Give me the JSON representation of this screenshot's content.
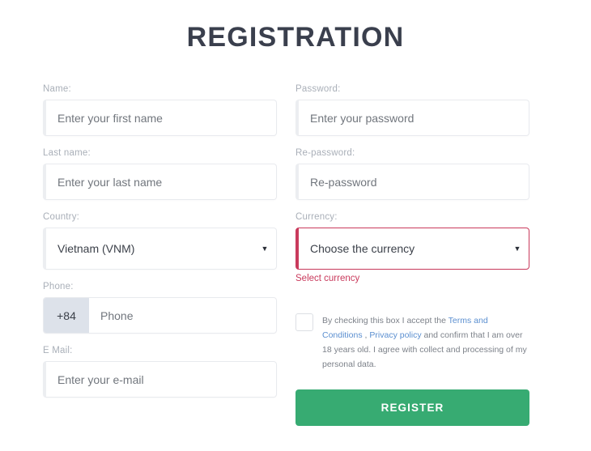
{
  "header": {
    "title": "REGISTRATION"
  },
  "form": {
    "left": {
      "name": {
        "label": "Name:",
        "placeholder": "Enter your first name",
        "value": ""
      },
      "last_name": {
        "label": "Last name:",
        "placeholder": "Enter your last name",
        "value": ""
      },
      "country": {
        "label": "Country:",
        "selected": "Vietnam (VNM)",
        "caret": "▼"
      },
      "phone": {
        "label": "Phone:",
        "prefix": "+84",
        "placeholder": "Phone",
        "value": ""
      },
      "email": {
        "label": "E Mail:",
        "placeholder": "Enter your e-mail",
        "value": ""
      }
    },
    "right": {
      "password": {
        "label": "Password:",
        "placeholder": "Enter your password",
        "value": ""
      },
      "re_password": {
        "label": "Re-password:",
        "placeholder": "Re-password",
        "value": ""
      },
      "currency": {
        "label": "Currency:",
        "selected": "Choose the currency",
        "caret": "▼",
        "error": "Select currency"
      },
      "terms": {
        "part1": "By checking this box I accept the ",
        "link1": "Terms and Conditions",
        "part2": " , ",
        "link2": "Privacy policy",
        "part3": " and confirm that I am over 18 years old. I agree with collect and processing of my personal data.",
        "checked": false
      },
      "submit": {
        "label": "REGISTER"
      }
    }
  },
  "colors": {
    "title": "#3a3f4d",
    "label": "#a9afb8",
    "placeholder": "#71767d",
    "error": "#c93a5c",
    "link": "#5b8fd0",
    "accent_green": "#37ab72",
    "phone_prefix_bg": "#dde2ea",
    "input_border": "#e8eaee"
  }
}
